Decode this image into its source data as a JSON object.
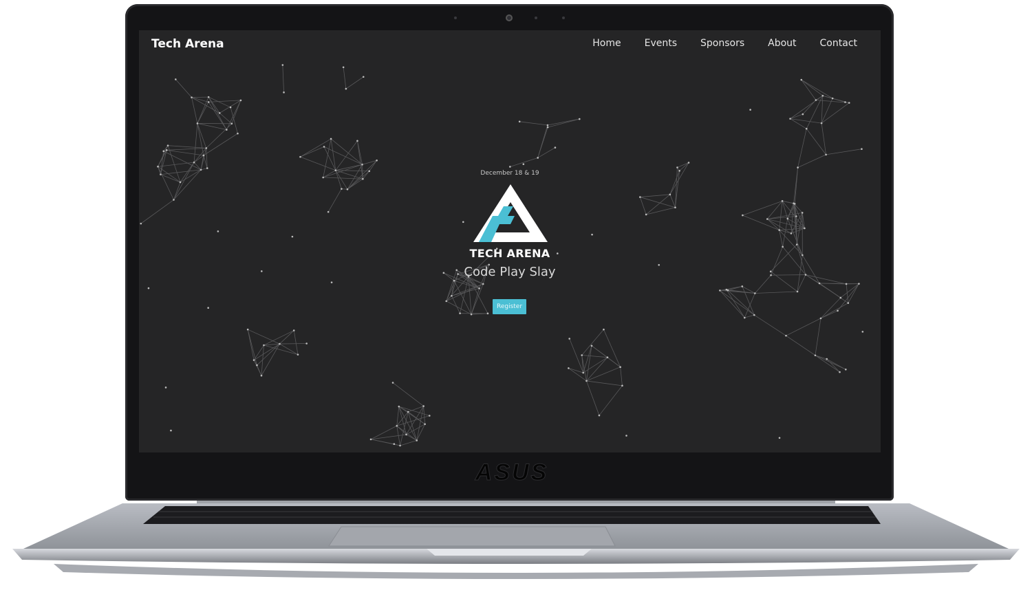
{
  "site": {
    "brand": "Tech Arena",
    "nav": [
      "Home",
      "Events",
      "Sponsors",
      "About",
      "Contact"
    ]
  },
  "hero": {
    "date": "December 18 & 19",
    "logo_text": "TECH ARENA",
    "tagline": "Code Play Slay",
    "register_label": "Register"
  },
  "device": {
    "brand_logo": "ASUS"
  },
  "colors": {
    "screen_bg": "#252526",
    "accent": "#4bbfd4",
    "text": "#ffffff"
  },
  "icons": [
    "webcam-icon",
    "tech-arena-logo-icon",
    "asus-logo"
  ]
}
